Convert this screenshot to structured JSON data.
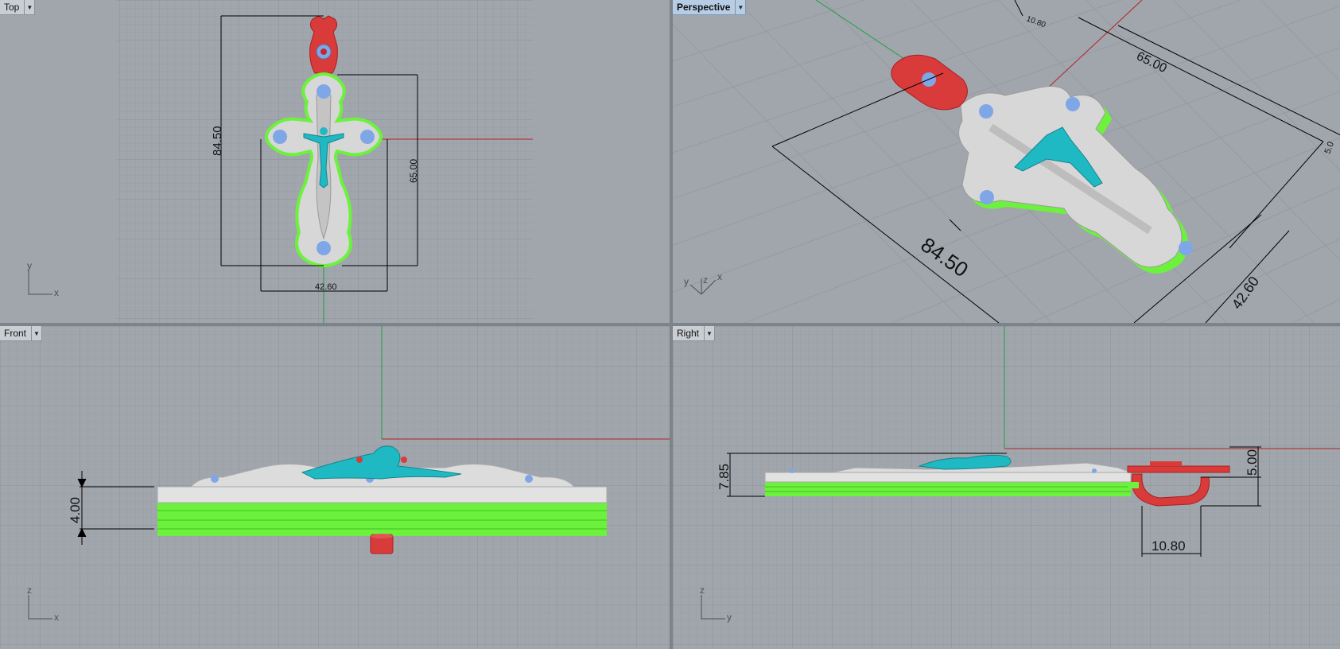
{
  "viewports": {
    "top": {
      "title": "Top"
    },
    "perspective": {
      "title": "Perspective"
    },
    "front": {
      "title": "Front"
    },
    "right": {
      "title": "Right"
    }
  },
  "dimensions": {
    "top": {
      "height": "84.50",
      "upper_height": "65.00",
      "width": "42.60"
    },
    "perspective": {
      "length": "65.00",
      "height": "84.50",
      "width": "42.60",
      "bail": "10.80",
      "bail_partial": "5.0"
    },
    "front": {
      "thickness": "4.00"
    },
    "right": {
      "total_thickness": "7.85",
      "bail_height": "5.00",
      "bail_width": "10.80"
    }
  },
  "axes": {
    "top": [
      "y",
      "x"
    ],
    "perspective": [
      "y",
      "z",
      "x"
    ],
    "front": [
      "z",
      "x"
    ],
    "right": [
      "z",
      "y"
    ]
  },
  "colors": {
    "viewport_bg": "#a1a6ad",
    "grid_minor": "#9aa0a6",
    "grid_major": "#8c9299",
    "x_axis": "#b22222",
    "y_axis": "#1e9e3a",
    "bail": "#d93b3b",
    "cross_body": "#d7d7d7",
    "backing": "#6cf23c",
    "corpus": "#1fb9c4",
    "gems": "#7fa6e6"
  },
  "icons": {
    "menu": "dropdown-arrow-icon"
  }
}
